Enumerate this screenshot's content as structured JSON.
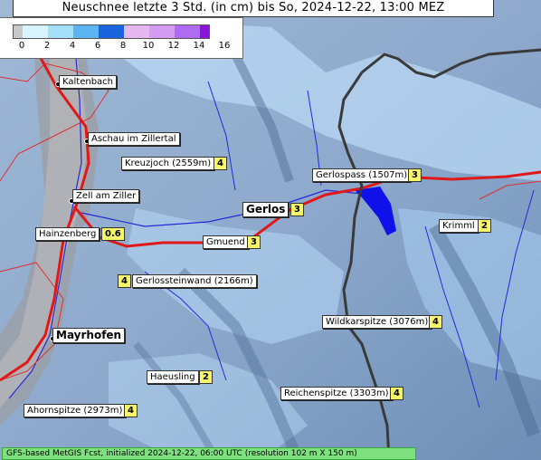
{
  "title": "Neuschnee letzte 3 Std. (in cm) bis So, 2024-12-22, 13:00 MEZ",
  "legend": {
    "ticks": [
      "0",
      "2",
      "4",
      "6",
      "8",
      "10",
      "12",
      "14",
      "16"
    ],
    "colors": [
      "#c8c8c8",
      "#d8f4ff",
      "#a4e0f8",
      "#5cb4f0",
      "#1a64e0",
      "#e6b8f0",
      "#d49cf0",
      "#b06cf0",
      "#8a14d8"
    ]
  },
  "places": [
    {
      "id": "kaltenbach",
      "name": "Kaltenbach"
    },
    {
      "id": "aschau",
      "name": "Aschau im Zillertal"
    },
    {
      "id": "kreuzjoch",
      "name": "Kreuzjoch (2559m)",
      "value": "4"
    },
    {
      "id": "zell",
      "name": "Zell am Ziller"
    },
    {
      "id": "hainzenberg",
      "name": "Hainzenberg",
      "value": "0.6"
    },
    {
      "id": "gerlos",
      "name": "Gerlos",
      "value": "3"
    },
    {
      "id": "gmuend",
      "name": "Gmuend",
      "value": "3"
    },
    {
      "id": "gerlospass",
      "name": "Gerlospass (1507m)",
      "value": "3"
    },
    {
      "id": "krimml",
      "name": "Krimml",
      "value": "2"
    },
    {
      "id": "gerlossteinwand",
      "name": "Gerlossteinwand (2166m)",
      "value": "4"
    },
    {
      "id": "wildkarspitze",
      "name": "Wildkarspitze (3076m)",
      "value": "4"
    },
    {
      "id": "mayrhofen",
      "name": "Mayrhofen"
    },
    {
      "id": "haeusling",
      "name": "Haeusling",
      "value": "2"
    },
    {
      "id": "reichenspitze",
      "name": "Reichenspitze (3303m)",
      "value": "4"
    },
    {
      "id": "ahornspitze",
      "name": "Ahornspitze (2973m)",
      "value": "4"
    }
  ],
  "footer": "GFS-based MetGIS Fcst, initialized 2024-12-22, 06:00 UTC  (resolution 102 m X 150 m)"
}
